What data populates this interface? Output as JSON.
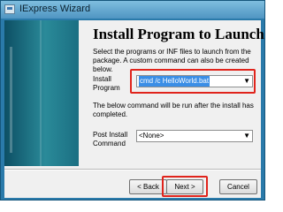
{
  "window": {
    "title": "IExpress Wizard"
  },
  "heading": "Install Program to Launch",
  "description": "Select the programs or INF files to launch from the package.  A custom command can also be created below.",
  "install_program": {
    "label_lines": [
      "Install",
      "Program"
    ],
    "value": "cmd /c HelloWorld.bat"
  },
  "middle_text": "The below command will be run after the install has completed.",
  "post_install": {
    "label_lines": [
      "Post Install",
      "Command"
    ],
    "value": "<None>"
  },
  "buttons": {
    "back": "< Back",
    "next": "Next >",
    "cancel": "Cancel"
  },
  "icons": {
    "app": "app-icon",
    "dropdown": "chevron-down-icon"
  },
  "colors": {
    "highlight_box": "#e0241c",
    "selection": "#3a8ee6",
    "title_bar": "#5fa4cf"
  }
}
